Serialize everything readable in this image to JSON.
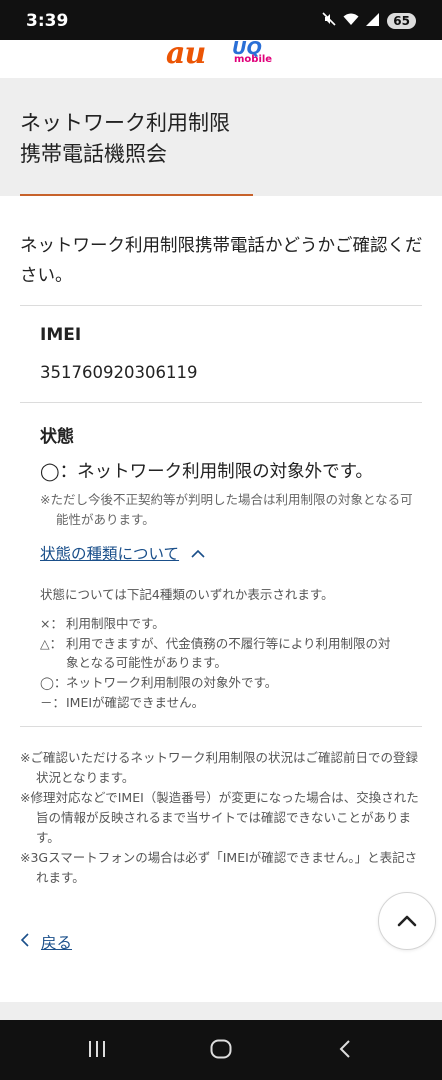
{
  "status_bar": {
    "time": "3:39",
    "battery": "65",
    "icons": [
      "mute-icon",
      "wifi-icon",
      "signal-icon",
      "battery-icon"
    ]
  },
  "header": {
    "logo_au": "au",
    "logo_uq": "UQ",
    "logo_mobile": "mobile"
  },
  "page": {
    "title_line1": "ネットワーク利用制限",
    "title_line2": "携帯電話機照会",
    "intro": "ネットワーク利用制限携帯電話かどうかご確認ください。"
  },
  "imei": {
    "label": "IMEI",
    "value": "351760920306119"
  },
  "status": {
    "label": "状態",
    "value": "◯：ネットワーク利用制限の対象外です。",
    "note": "※ただし今後不正契約等が判明した場合は利用制限の対象となる可能性があります。"
  },
  "types": {
    "toggle_label": "状態の種類について",
    "intro": "状態については下記4種類のいずれか表示されます。",
    "items": [
      {
        "symbol": "×：",
        "text": "利用制限中です。"
      },
      {
        "symbol": "△：",
        "text": "利用できますが、代金債務の不履行等により利用制限の対象となる可能性があります。"
      },
      {
        "symbol": "◯：",
        "text": "ネットワーク利用制限の対象外です。"
      },
      {
        "symbol": "－：",
        "text": "IMEIが確認できません。"
      }
    ]
  },
  "footnotes": [
    "※ご確認いただけるネットワーク利用制限の状況はご確認前日での登録状況となります。",
    "※修理対応などでIMEI（製造番号）が変更になった場合は、交換された旨の情報が反映されるまで当サイトでは確認できないことがあります。",
    "※3Gスマートフォンの場合は必ず「IMEIが確認できません。」と表記されます。"
  ],
  "nav": {
    "back_label": "戻る"
  },
  "colors": {
    "accent": "#c7622b",
    "link": "#1a4f8a",
    "au_orange": "#eb5505"
  }
}
